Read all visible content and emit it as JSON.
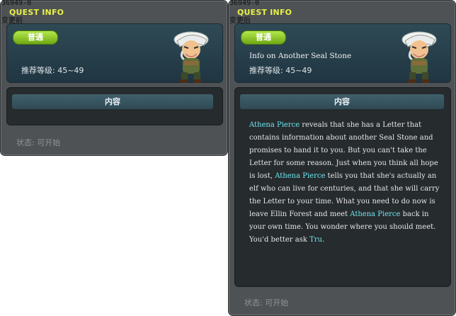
{
  "left_panel": {
    "quest_id": "36949-0",
    "title": "QUEST INFO",
    "variant_label": "变更前",
    "badge": "普通",
    "quest_name": "",
    "recommended_level": "推荐等级: 45~49",
    "content_header": "内容",
    "status": "状态: 可开始",
    "npc_icon": "old-man-npc-portrait"
  },
  "right_panel": {
    "quest_id": "36949-0",
    "title": "QUEST INFO",
    "variant_label": "变更后",
    "badge": "普通",
    "quest_name": "Info on Another Seal Stone",
    "recommended_level": "推荐等级: 45~49",
    "content_header": "内容",
    "status": "状态: 可开始",
    "npc_icon": "old-man-npc-portrait",
    "content_segments": [
      {
        "text": "Athena Pierce",
        "highlight": true
      },
      {
        "text": " reveals that she has a Letter that contains information about another Seal Stone and promises to hand it to you. But you can't take the Letter for some reason. Just when you think all hope is lost, ",
        "highlight": false
      },
      {
        "text": "Athena Pierce",
        "highlight": true
      },
      {
        "text": " tells you that she's actually an elf who can live for centuries, and that she will carry the Letter to your time. What you need to do now is leave Ellin Forest and meet ",
        "highlight": false
      },
      {
        "text": "Athena Pierce",
        "highlight": true
      },
      {
        "text": " back in your own time. You wonder where you should meet. You'd better ask ",
        "highlight": false
      },
      {
        "text": "Tru",
        "highlight": true
      },
      {
        "text": ".",
        "highlight": false
      }
    ]
  },
  "colors": {
    "title_yellow": "#e8f04a",
    "badge_green": "#8ccf24",
    "highlight_cyan": "#6fe6f0",
    "panel_gray": "#4e5254",
    "content_dark": "#262b2e"
  }
}
